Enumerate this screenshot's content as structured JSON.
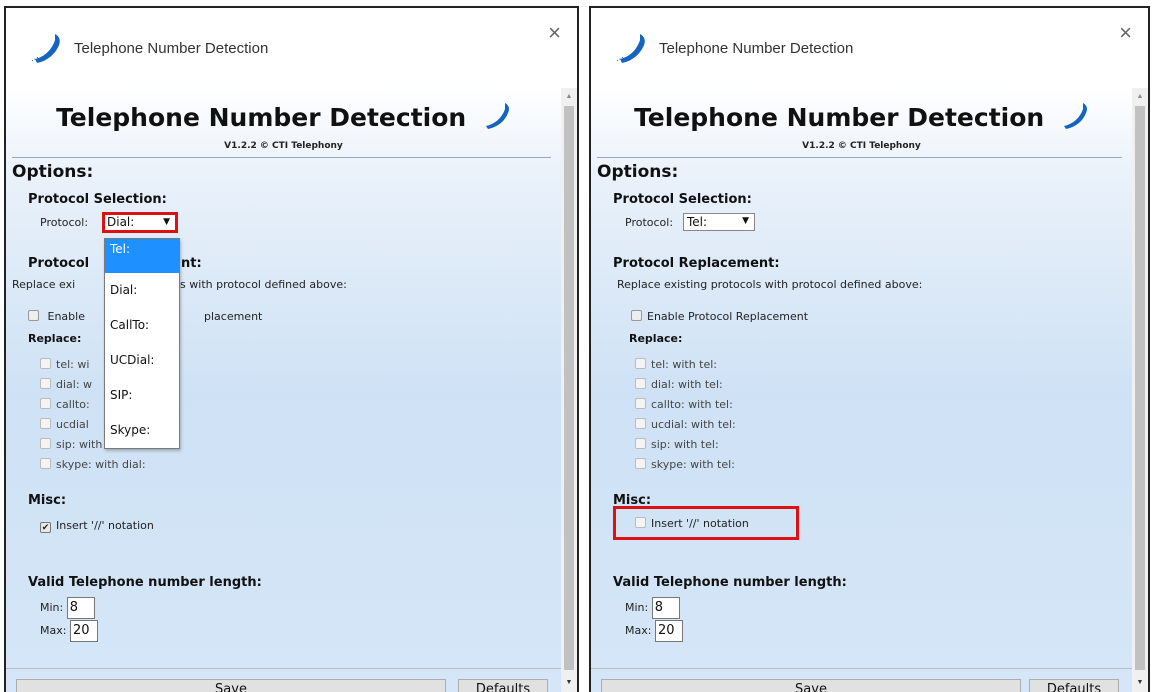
{
  "left": {
    "window_title": "Telephone Number Detection",
    "close": "×",
    "heading": "Telephone Number Detection",
    "version": "V1.2.2 © CTI Telephony",
    "options": "Options:",
    "protocol_selection": "Protocol Selection:",
    "protocol_label": "Protocol:",
    "protocol_value": "Dial:",
    "protocol_replacement_visible_1": "Protocol",
    "protocol_replacement_visible_2": "nt:",
    "replace_desc_visible_1": "Replace exi",
    "replace_desc_visible_2": "ls with protocol defined above:",
    "enable_visible_1": "Enable",
    "enable_visible_2": "placement",
    "replace_title": "Replace:",
    "replace_items_visible": [
      "tel: wi",
      "dial: w",
      "callto:",
      "ucdial",
      "sip: with dial:",
      "skype: with dial:"
    ],
    "misc": "Misc:",
    "insert_notation": "Insert '//' notation",
    "valid_length": "Valid Telephone number length:",
    "min_label": "Min:",
    "min_value": "8",
    "max_label": "Max:",
    "max_value": "20",
    "save_button": "Save",
    "defaults_button": "Defaults",
    "dropdown_options": [
      "Tel:",
      "Dial:",
      "CallTo:",
      "UCDial:",
      "SIP:",
      "Skype:"
    ],
    "dropdown_selected": "Tel:"
  },
  "right": {
    "window_title": "Telephone Number Detection",
    "close": "×",
    "heading": "Telephone Number Detection",
    "version": "V1.2.2 © CTI Telephony",
    "options": "Options:",
    "protocol_selection": "Protocol Selection:",
    "protocol_label": "Protocol:",
    "protocol_value": "Tel:",
    "protocol_replacement": "Protocol Replacement:",
    "replace_desc": "Replace existing protocols with protocol defined above:",
    "enable_replacement": "Enable Protocol Replacement",
    "replace_title": "Replace:",
    "replace_items": [
      "tel: with tel:",
      "dial: with tel:",
      "callto: with tel:",
      "ucdial: with tel:",
      "sip: with tel:",
      "skype: with tel:"
    ],
    "misc": "Misc:",
    "insert_notation": "Insert '//' notation",
    "valid_length": "Valid Telephone number length:",
    "min_label": "Min:",
    "min_value": "8",
    "max_label": "Max:",
    "max_value": "20",
    "save_button": "Save",
    "defaults_button": "Defaults"
  },
  "colors": {
    "highlight": "#dd1111",
    "dropdown_selected": "#1e90ff",
    "phone_icon": "#1565c0"
  },
  "icons": [
    "phone-icon",
    "close-icon",
    "dropdown-arrow-icon",
    "checkbox-icon"
  ],
  "state": {
    "left_insert_notation_checked": true,
    "right_insert_notation_checked": false,
    "left_dropdown_open": true
  }
}
